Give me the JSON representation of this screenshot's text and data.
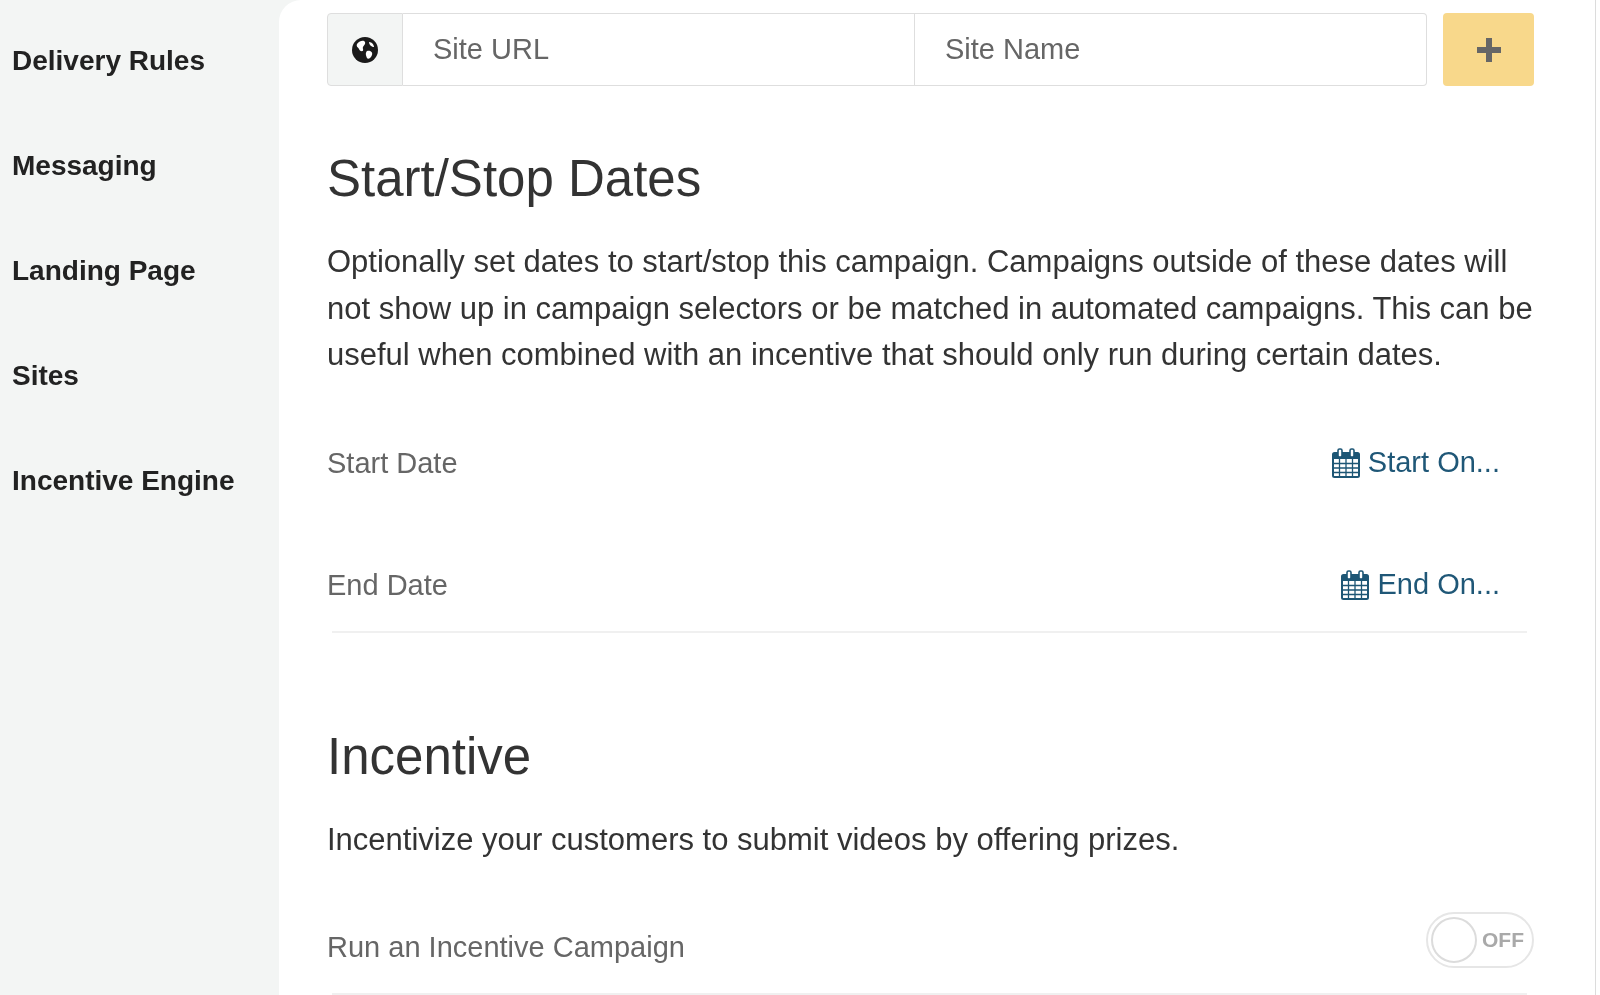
{
  "sidebar": {
    "items": [
      {
        "label": "Delivery Rules"
      },
      {
        "label": "Messaging"
      },
      {
        "label": "Landing Page"
      },
      {
        "label": "Sites"
      },
      {
        "label": "Incentive Engine"
      }
    ]
  },
  "site_form": {
    "url_field": {
      "placeholder": "Site URL"
    },
    "name_field": {
      "placeholder": "Site Name"
    }
  },
  "sections": [
    {
      "title": "Start/Stop Dates",
      "description": "Optionally set dates to start/stop this campaign. Campaigns outside of these dates will not show up in campaign selectors or be matched in automated campaigns. This can be useful when combined with an incentive that should only run during certain dates.",
      "rows": [
        {
          "kind": "date",
          "label": "Start Date",
          "action": "Start On..."
        },
        {
          "kind": "date",
          "label": "End Date",
          "action": "End On..."
        }
      ]
    },
    {
      "title": "Incentive",
      "description": "Incentivize your customers to submit videos by offering prizes.",
      "rows": [
        {
          "kind": "toggle",
          "label": "Run an Incentive Campaign",
          "on": false,
          "state_text": "OFF"
        }
      ]
    }
  ]
}
